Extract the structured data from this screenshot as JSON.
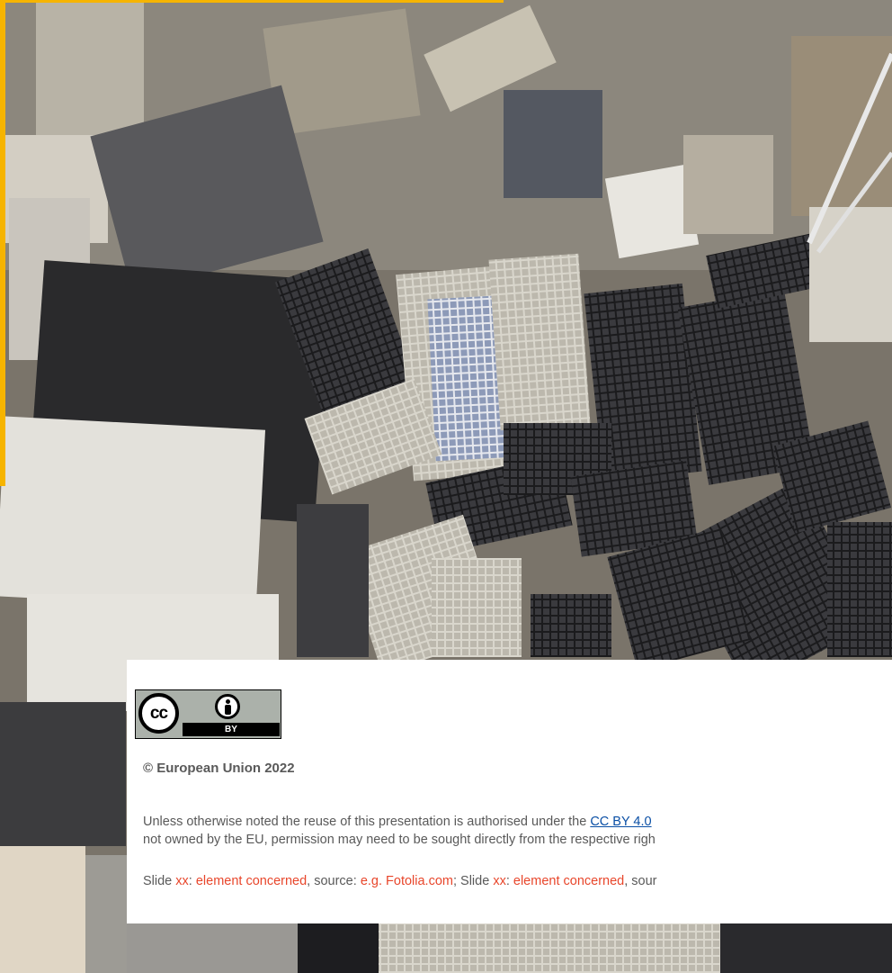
{
  "background": {
    "subject": "pile of discarded keyboards and computer hardware (e-waste)",
    "accent_color": "#f6b400"
  },
  "license_badge": {
    "cc_label": "cc",
    "by_label": "BY"
  },
  "copyright": "© European Union 2022",
  "license": {
    "prefix": "Unless otherwise noted the reuse of this presentation is authorised under the ",
    "link_text": "CC BY 4.0",
    "line2": "not owned by the EU, permission may need to be sought directly from the respective righ"
  },
  "credits": {
    "slide1_label": "Slide ",
    "slide1_num": "xx",
    "sep1": ": ",
    "element1": "element concerned",
    "source1_label": ", source: ",
    "source1": "e.g. Fotolia.com",
    "slide2_label": "; Slide ",
    "slide2_num": "xx",
    "sep2": ": ",
    "element2": "element concerned",
    "source2_label": ", sour"
  },
  "colors": {
    "link": "#0a4fa5",
    "placeholder_red": "#e8462b",
    "body_text": "#595959"
  }
}
